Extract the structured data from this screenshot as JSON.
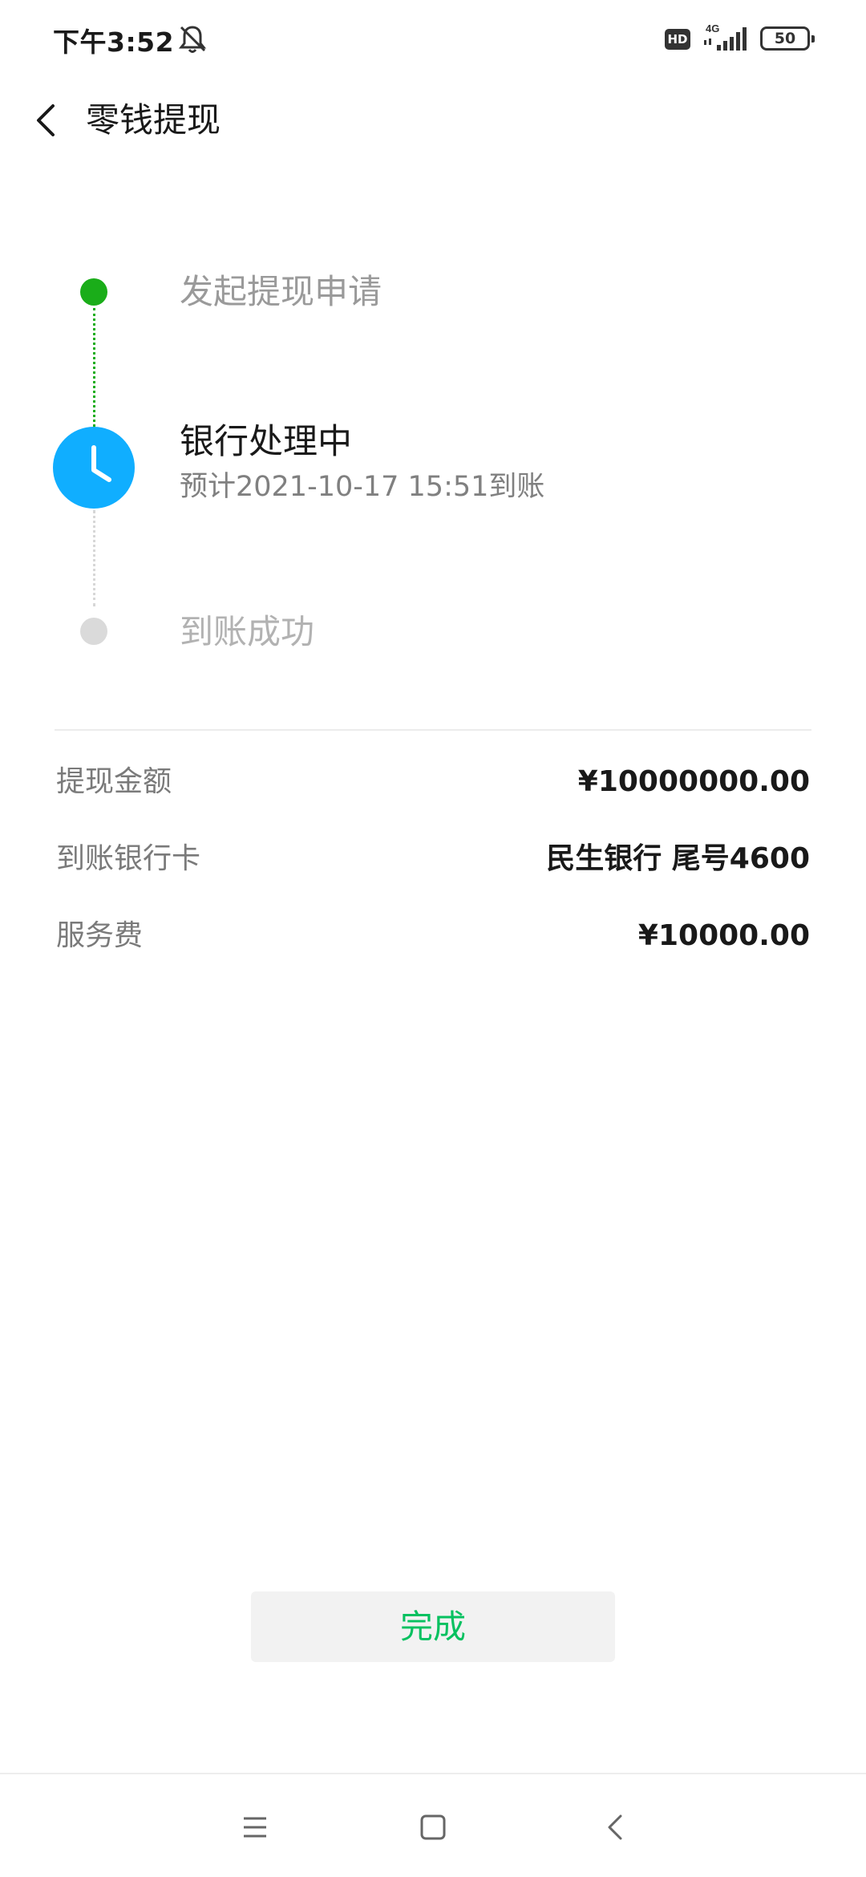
{
  "status_bar": {
    "time": "下午3:52",
    "network": "4G",
    "hd_badge": "HD",
    "battery": "50",
    "mute_icon": "bell-off-icon",
    "signal_icon": "cell-signal-icon"
  },
  "header": {
    "title": "零钱提现",
    "back_icon": "chevron-left-icon"
  },
  "timeline": {
    "steps": [
      {
        "label": "发起提现申请",
        "status": "done"
      },
      {
        "label": "银行处理中",
        "sub": "预计2021-10-17 15:51到账",
        "status": "current",
        "icon": "clock-icon"
      },
      {
        "label": "到账成功",
        "status": "pending"
      }
    ],
    "colors": {
      "done": "#1aad19",
      "current": "#10aeff",
      "pending": "#dadada"
    }
  },
  "details": [
    {
      "label": "提现金额",
      "value": "¥10000000.00"
    },
    {
      "label": "到账银行卡",
      "value": "民生银行 尾号4600"
    },
    {
      "label": "服务费",
      "value": "¥10000.00"
    }
  ],
  "actions": {
    "done_label": "完成",
    "done_color": "#07c160"
  },
  "system_nav": {
    "menu_icon": "menu-icon",
    "home_icon": "home-square-icon",
    "back_icon": "back-triangle-icon"
  }
}
